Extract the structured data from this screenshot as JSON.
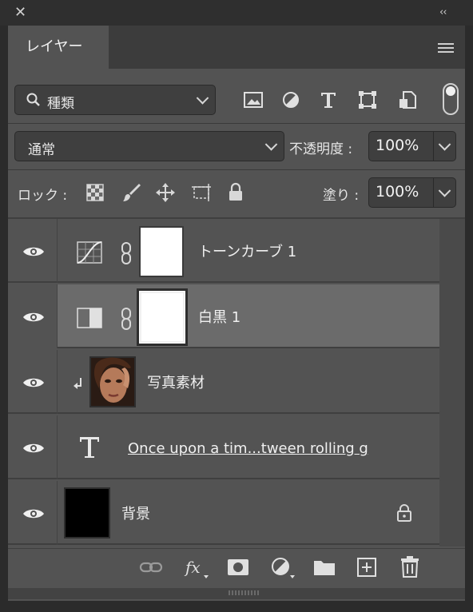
{
  "window": {
    "close_icon": "close-icon",
    "collapse_label": "‹‹"
  },
  "tab": {
    "label": "レイヤー"
  },
  "filter": {
    "label": "種類"
  },
  "blend": {
    "mode": "通常",
    "opacity_label": "不透明度 :",
    "opacity_value": "100%"
  },
  "lock": {
    "label": "ロック :",
    "fill_label": "塗り :",
    "fill_value": "100%"
  },
  "layers": [
    {
      "name": "トーンカーブ 1"
    },
    {
      "name": "白黒 1"
    },
    {
      "name": "写真素材"
    },
    {
      "name": "Once upon a tim...tween rolling g"
    },
    {
      "name": "背景"
    }
  ]
}
